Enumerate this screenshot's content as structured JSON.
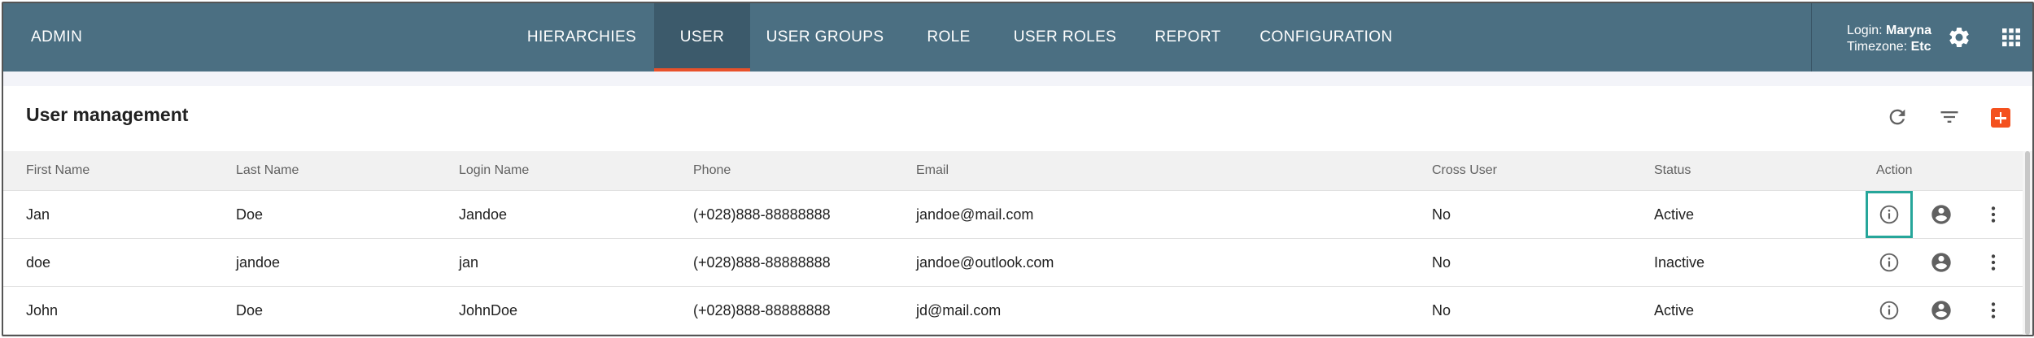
{
  "header": {
    "brand": "ADMIN",
    "nav": [
      {
        "label": "HIERARCHIES"
      },
      {
        "label": "USER",
        "active": true
      },
      {
        "label": "USER GROUPS"
      },
      {
        "label": "ROLE"
      },
      {
        "label": "USER ROLES"
      },
      {
        "label": "REPORT"
      },
      {
        "label": "CONFIGURATION"
      }
    ],
    "login_label": "Login:",
    "login_value": "Maryna",
    "timezone_label": "Timezone:",
    "timezone_value": "Etc",
    "icons": {
      "settings": "gear-icon",
      "apps": "apps-grid-icon"
    }
  },
  "page": {
    "title": "User management",
    "toolbar_icons": [
      "refresh-icon",
      "filter-icon",
      "add-icon"
    ],
    "accent_color": "#f4511e",
    "header_color": "#4b6f82"
  },
  "table": {
    "columns": [
      "First Name",
      "Last Name",
      "Login Name",
      "Phone",
      "Email",
      "Cross User",
      "Status",
      "Action"
    ],
    "rows": [
      {
        "first": "Jan",
        "last": "Doe",
        "login": "Jandoe",
        "phone": "(+028)888-88888888",
        "email": "jandoe@mail.com",
        "cross": "No",
        "status": "Active"
      },
      {
        "first": "doe",
        "last": "jandoe",
        "login": "jan",
        "phone": "(+028)888-88888888",
        "email": "jandoe@outlook.com",
        "cross": "No",
        "status": "Inactive"
      },
      {
        "first": "John",
        "last": "Doe",
        "login": "JohnDoe",
        "phone": "(+028)888-88888888",
        "email": "jd@mail.com",
        "cross": "No",
        "status": "Active"
      }
    ],
    "row_action_icons": [
      "info-icon",
      "account-icon",
      "more-vert-icon"
    ],
    "highlight_color": "#26a69a"
  }
}
